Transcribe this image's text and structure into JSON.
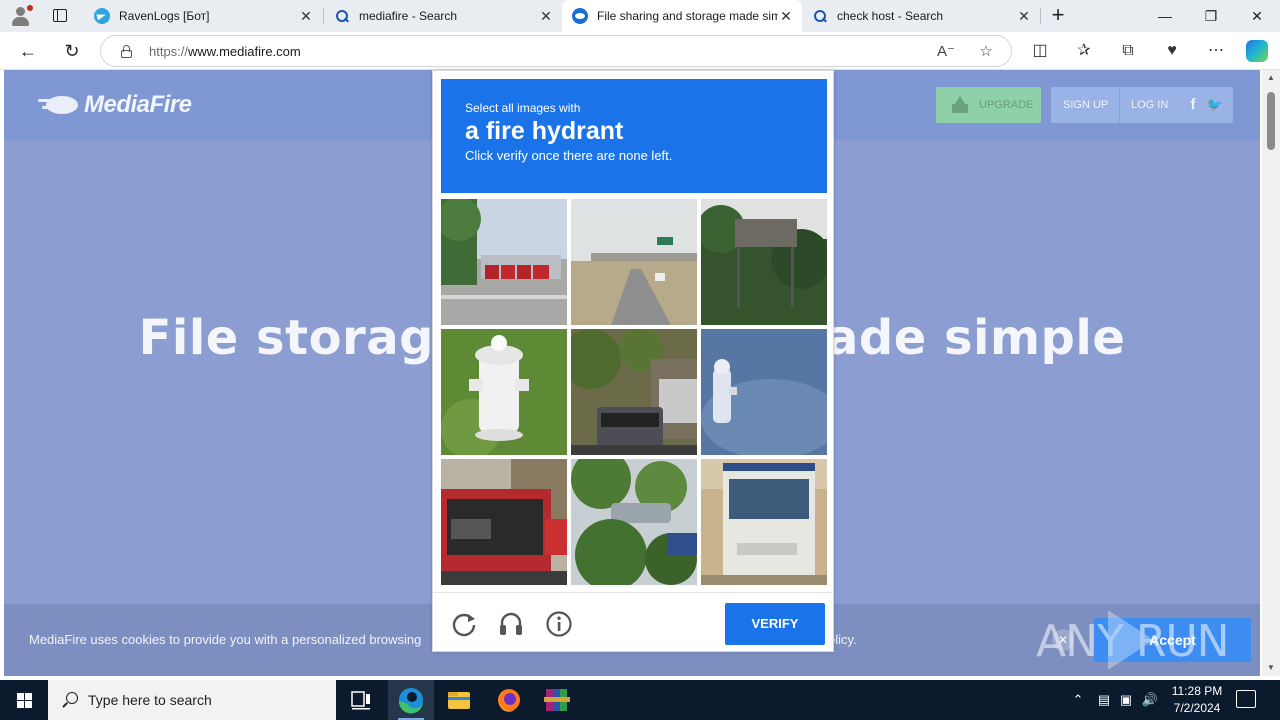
{
  "browser": {
    "tabs": [
      {
        "label": "RavenLogs [Бот]",
        "icon": "telegram-icon",
        "active": false
      },
      {
        "label": "mediafire - Search",
        "icon": "search-icon",
        "active": false
      },
      {
        "label": "File sharing and storage made sim",
        "icon": "mediafire-icon",
        "active": true
      },
      {
        "label": "check host - Search",
        "icon": "search-icon",
        "active": false
      }
    ],
    "close_glyph": "✕",
    "new_tab_glyph": "+",
    "window": {
      "minimize": "—",
      "maximize": "❐",
      "close": "✕"
    },
    "url_prefix": "https://",
    "url_host": "www.mediafire.com"
  },
  "site": {
    "logo_text": "MediaFire",
    "upgrade_label": "UPGRADE",
    "signup_label": "SIGN UP",
    "login_label": "LOG IN",
    "facebook_glyph": "f",
    "twitter_glyph": "🐦",
    "hero_left": "File storag",
    "hero_right": "ade simple",
    "cookie_text": "MediaFire uses cookies to provide you with a personalized browsing",
    "cookie_tail": "Policy.",
    "cookie_close": "✕",
    "accept_label": "Accept"
  },
  "captcha": {
    "prompt_small": "Select all images with",
    "prompt_big": "a fire hydrant",
    "instruction": "Click verify once there are none left.",
    "verify_label": "VERIFY",
    "tiles": [
      "trucks-parking-lot",
      "highway-overpass",
      "highway-sign-trees",
      "white-fire-hydrant-grass",
      "street-with-cars",
      "hydrant-in-snow",
      "red-bus-street",
      "green-bush-car",
      "white-bus"
    ]
  },
  "watermark": {
    "text": "ANY RUN"
  },
  "taskbar": {
    "search_placeholder": "Type here to search",
    "time": "11:28 PM",
    "date": "7/2/2024"
  },
  "colors": {
    "captcha_blue": "#1a73e8",
    "page_overlay": "#8c9ed1",
    "upgrade_green": "#8ed1a8"
  }
}
